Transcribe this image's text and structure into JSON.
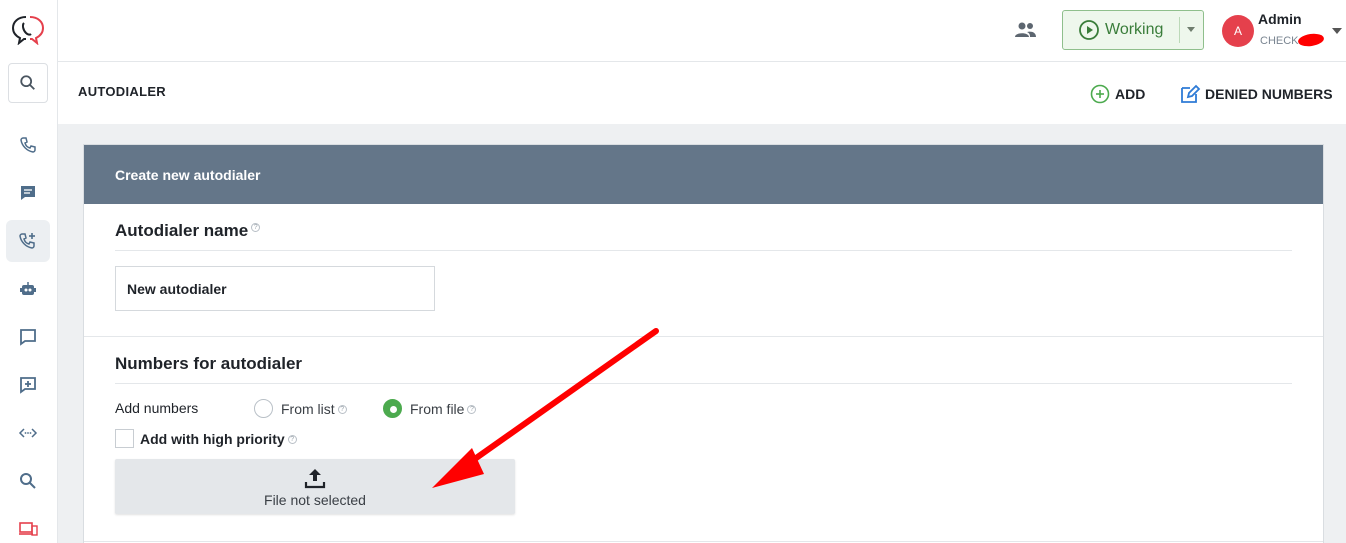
{
  "colors": {
    "accent_green": "#4caa4e",
    "card_header": "#647689",
    "avatar_bg": "#e5404c",
    "annotation_arrow": "#ff0000"
  },
  "topbar": {
    "team_icon": "users-icon",
    "status": {
      "label": "Working",
      "icon": "play-circle-icon"
    },
    "user": {
      "initial": "A",
      "name": "Admin",
      "subtitle": "CHECK"
    }
  },
  "sidebar": {
    "logo": "chat-phone-logo",
    "items": [
      {
        "icon": "search-icon"
      },
      {
        "icon": "phone-icon"
      },
      {
        "icon": "message-icon"
      },
      {
        "icon": "phone-add-icon",
        "active": true
      },
      {
        "icon": "robot-icon"
      },
      {
        "icon": "chat-icon"
      },
      {
        "icon": "medical-chat-icon"
      },
      {
        "icon": "code-icon"
      },
      {
        "icon": "search-icon"
      },
      {
        "icon": "devices-icon"
      }
    ]
  },
  "page": {
    "title": "AUTODIALER",
    "add_label": "ADD",
    "denied_label": "DENIED NUMBERS"
  },
  "card": {
    "title": "Create new autodialer",
    "name_section": "Autodialer name",
    "name_value": "New autodialer",
    "numbers_section": "Numbers for autodialer",
    "add_numbers_label": "Add numbers",
    "from_list": "From list",
    "from_file": "From file",
    "selected_source": "From file",
    "high_priority": "Add with high priority",
    "high_priority_checked": false,
    "file_status": "File not selected"
  },
  "help_glyph": "?"
}
